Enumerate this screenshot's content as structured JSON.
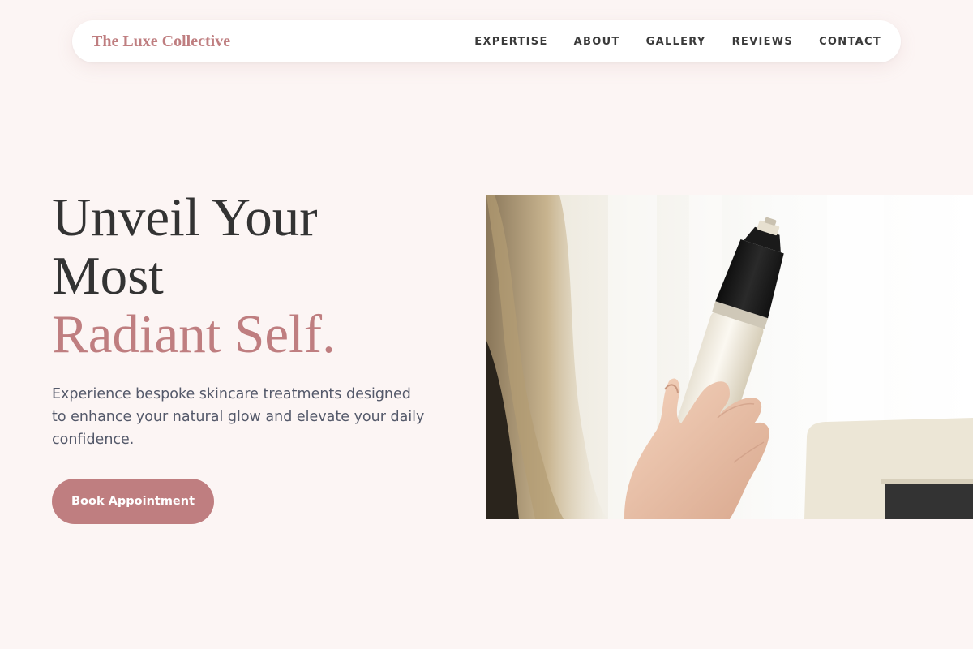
{
  "nav": {
    "brand": "The Luxe Collective",
    "links": [
      "EXPERTISE",
      "ABOUT",
      "GALLERY",
      "REVIEWS",
      "CONTACT"
    ]
  },
  "hero": {
    "headline_line1": "Unveil Your",
    "headline_line2": "Most",
    "headline_accent": "Radiant Self.",
    "subtext": "Experience bespoke skincare treatments designed to enhance your natural glow and elevate your daily confidence.",
    "cta_label": "Book Appointment",
    "image_icon": "skincare-device-photo"
  },
  "colors": {
    "background": "#fcf5f4",
    "accent": "#bf7e80",
    "heading": "#333333",
    "body_text": "#54596a",
    "nav_text": "#3a3a3a"
  }
}
